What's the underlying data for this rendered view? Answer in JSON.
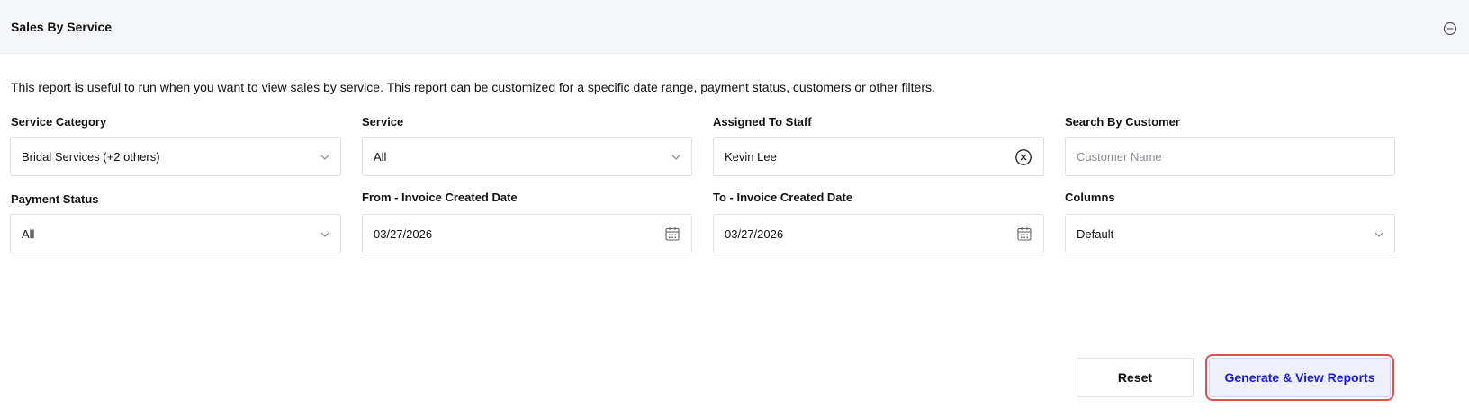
{
  "panel": {
    "title": "Sales By Service",
    "collapse_icon": "minus-circle-icon",
    "description": "This report is useful to run when you want to view sales by service. This report can be customized for a specific date range, payment status, customers or other filters."
  },
  "filters": {
    "service_category": {
      "label": "Service Category",
      "value": "Bridal Services (+2 others)"
    },
    "service": {
      "label": "Service",
      "value": "All"
    },
    "assigned_staff": {
      "label": "Assigned To Staff",
      "value": "Kevin Lee"
    },
    "search_customer": {
      "label": "Search By Customer",
      "placeholder": "Customer Name"
    },
    "payment_status": {
      "label": "Payment Status",
      "value": "All"
    },
    "from_date": {
      "label": "From - Invoice Created Date",
      "value": "03/27/2026"
    },
    "to_date": {
      "label": "To - Invoice Created Date",
      "value": "03/27/2026"
    },
    "columns": {
      "label": "Columns",
      "value": "Default"
    }
  },
  "actions": {
    "reset_label": "Reset",
    "generate_label": "Generate & View Reports"
  },
  "colors": {
    "accent": "#1a1adb",
    "highlight_ring": "#d9534f",
    "header_bg": "#f5f6f8"
  }
}
